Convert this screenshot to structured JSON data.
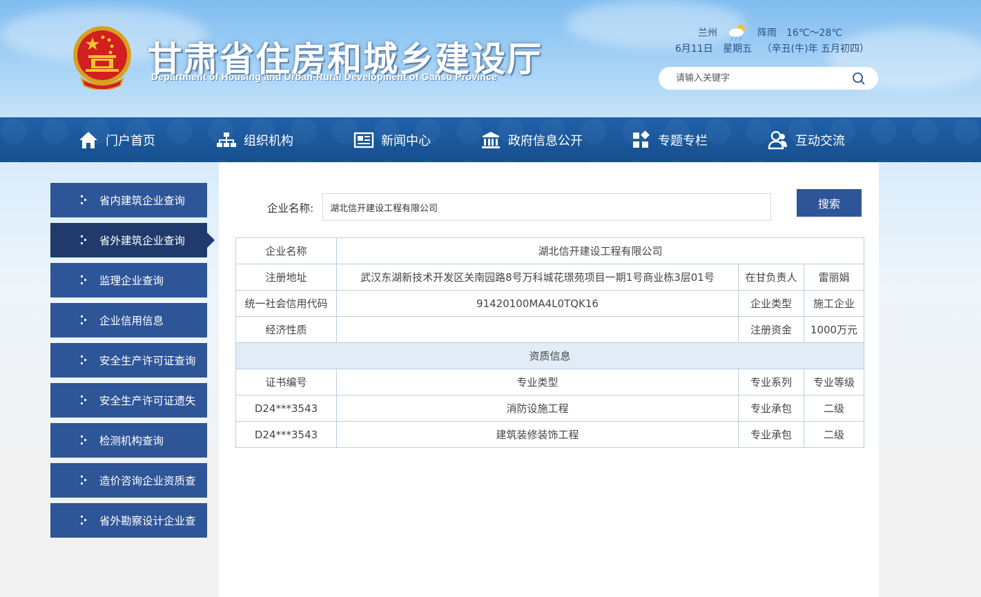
{
  "header": {
    "title": "甘肃省住房和城乡建设厅",
    "subtitle": "Department of Housing and Urban-Rural Development of Gansu Province",
    "weather": {
      "city": "兰州",
      "condition": "阵雨",
      "temperature": "16℃～28℃",
      "icon": "rain-cloud-icon"
    },
    "date": {
      "day": "6月11日",
      "weekday": "星期五",
      "lunar": "（辛丑(牛)年 五月初四）"
    },
    "search": {
      "placeholder": "请输入关键字"
    }
  },
  "nav": {
    "items": [
      {
        "label": "门户首页",
        "icon": "home-icon"
      },
      {
        "label": "组织机构",
        "icon": "org-chart-icon"
      },
      {
        "label": "新闻中心",
        "icon": "news-icon"
      },
      {
        "label": "政府信息公开",
        "icon": "government-building-icon"
      },
      {
        "label": "专题专栏",
        "icon": "grid-icon"
      },
      {
        "label": "互动交流",
        "icon": "users-icon"
      }
    ]
  },
  "sidebar": {
    "items": [
      {
        "label": "省内建筑企业查询"
      },
      {
        "label": "省外建筑企业查询",
        "active": true
      },
      {
        "label": "监理企业查询"
      },
      {
        "label": "企业信用信息"
      },
      {
        "label": "安全生产许可证查询"
      },
      {
        "label": "安全生产许可证遗失"
      },
      {
        "label": "检测机构查询"
      },
      {
        "label": "造价咨询企业资质查"
      },
      {
        "label": "省外勘察设计企业查"
      }
    ]
  },
  "query": {
    "label": "企业名称:",
    "value": "湖北信开建设工程有限公司",
    "button": "搜索"
  },
  "company": {
    "name_label": "企业名称",
    "name": "湖北信开建设工程有限公司",
    "address_label": "注册地址",
    "address": "武汉东湖新技术开发区关南园路8号万科城花璟苑项目一期1号商业栋3层01号",
    "gansu_rep_label": "在甘负责人",
    "gansu_rep": "雷丽娟",
    "credit_code_label": "统一社会信用代码",
    "credit_code": "91420100MA4L0TQK16",
    "type_label": "企业类型",
    "type": "施工企业",
    "economic_nature_label": "经济性质",
    "economic_nature": "",
    "capital_label": "注册资金",
    "capital": "1000万元"
  },
  "qualification": {
    "section_title": "资质信息",
    "headers": [
      "证书编号",
      "专业类型",
      "专业系列",
      "专业等级"
    ],
    "rows": [
      [
        "D24***3543",
        "消防设施工程",
        "专业承包",
        "二级"
      ],
      [
        "D24***3543",
        "建筑装修装饰工程",
        "专业承包",
        "二级"
      ]
    ]
  }
}
